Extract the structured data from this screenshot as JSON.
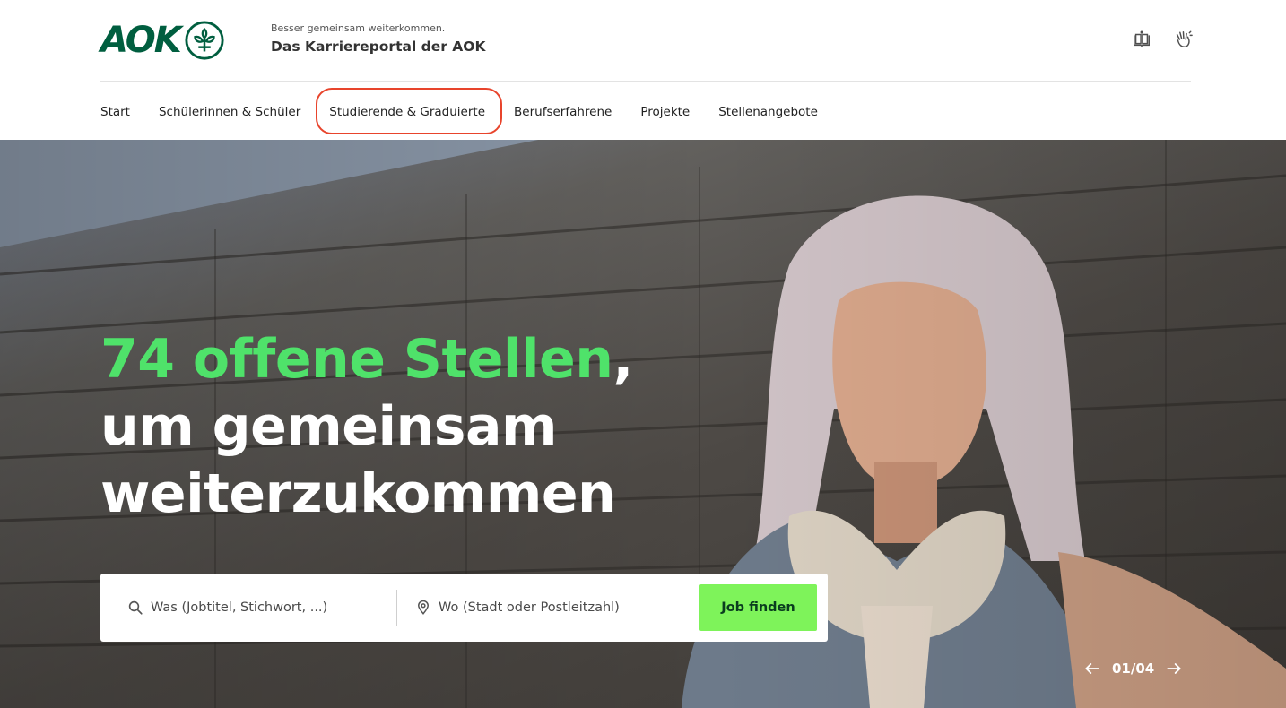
{
  "header": {
    "logo_text": "AOK",
    "tagline_small": "Besser gemeinsam weiterkommen.",
    "tagline_big": "Das Karriereportal der AOK",
    "utility_icons": [
      "easy-language-book-icon",
      "sign-language-hand-icon"
    ]
  },
  "nav": {
    "items": [
      {
        "label": "Start"
      },
      {
        "label": "Schülerinnen & Schüler"
      },
      {
        "label": "Studierende & Graduierte"
      },
      {
        "label": "Berufserfahrene"
      },
      {
        "label": "Projekte"
      },
      {
        "label": "Stellenangebote"
      }
    ],
    "highlighted_index": 2
  },
  "hero": {
    "headline_highlight": "74 offene Stellen",
    "headline_rest": ", um gemeinsam weiterzukommen",
    "search": {
      "what_placeholder": "Was (Jobtitel, Stichwort, ...)",
      "where_placeholder": "Wo (Stadt oder Postleitzahl)",
      "button_label": "Job finden"
    },
    "pager": {
      "count": "01/04"
    }
  },
  "colors": {
    "brand_green": "#005e3f",
    "highlight_green": "#4fe26a",
    "button_green": "#7ef35a",
    "annotation_red": "#e8442c"
  }
}
